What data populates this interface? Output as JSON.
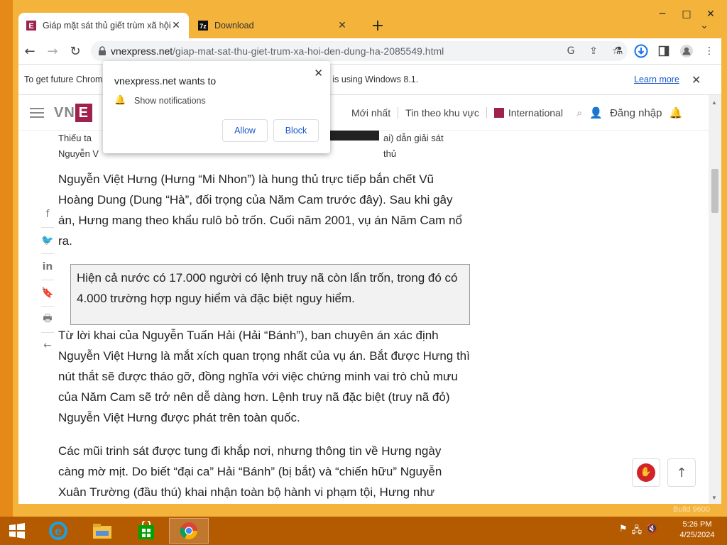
{
  "window": {
    "minimize": "─",
    "maximize": "□",
    "close": "✕"
  },
  "tabs": [
    {
      "title": "Giáp mặt sát thủ giết trùm xã hội đen",
      "close": "✕",
      "favicon": "vnexpress-favicon"
    },
    {
      "title": "Download",
      "close": "✕",
      "favicon": "7zip-favicon"
    }
  ],
  "new_tab": "+",
  "tab_search": "⌄",
  "toolbar": {
    "back": "←",
    "forward": "→",
    "reload": "↻",
    "url_host": "vnexpress.net",
    "url_path": "/giap-mat-sat-thu-giet-trum-xa-hoi-den-dung-ha-2085549.html"
  },
  "infobar": {
    "message": "To get future Chrome updates, you'll need Windows 10 or later. This computer is using Windows 8.1.",
    "learn_more": "Learn more",
    "close": "✕"
  },
  "popup": {
    "title": "vnexpress.net wants to",
    "permission": "Show notifications",
    "allow": "Allow",
    "block": "Block",
    "close": "✕"
  },
  "site": {
    "logo_left": "VN",
    "logo_e": "E",
    "nav": [
      "Mới nhất",
      "Tin theo khu vực",
      "International"
    ],
    "login": "Đăng nhập"
  },
  "caption": {
    "line1_left": "Thiếu ta",
    "line1_right": "ai) dẫn giải sát thủ",
    "line2": "Nguyễn V"
  },
  "article": {
    "p1": "Nguyễn Việt Hưng (Hưng “Mi Nhon”) là hung thủ trực tiếp bắn chết Vũ Hoàng Dung (Dung “Hà”, đối trọng của Năm Cam trước đây). Sau khi gây án, Hưng mang theo khẩu rulô bỏ trốn. Cuối năm 2001, vụ án Năm Cam nổ ra.",
    "quote": "Hiện cả nước có 17.000 người có lệnh truy nã còn lẩn trốn, trong đó có 4.000 trường hợp nguy hiểm và đặc biệt nguy hiểm.",
    "p2": "Từ lời khai của Nguyễn Tuấn Hải (Hải “Bánh”), ban chuyên án xác định Nguyễn Việt Hưng là mắt xích quan trọng nhất của vụ án. Bắt được Hưng thì nút thắt sẽ được tháo gỡ, đồng nghĩa với việc chứng minh vai trò chủ mưu của Năm Cam sẽ trở nên dễ dàng hơn. Lệnh truy nã đặc biệt (truy nã đỏ) Nguyễn Việt Hưng được phát trên toàn quốc.",
    "p3": "Các mũi trinh sát được tung đi khắp nơi, nhưng thông tin về Hưng ngày càng mờ mịt. Do biết “đại ca” Hải “Bánh” (bị bắt) và “chiến hữu” Nguyễn Xuân Trường (đầu thú) khai nhận toàn bộ hành vi phạm tội, Hưng như"
  },
  "taskbar": {
    "time": "5:26 PM",
    "date": "4/25/2024",
    "build": "Build 9600"
  },
  "colors": {
    "brand": "#9f224e",
    "link": "#1a57c8",
    "desktop": "#e58a18",
    "taskbar": "#b45a00"
  }
}
